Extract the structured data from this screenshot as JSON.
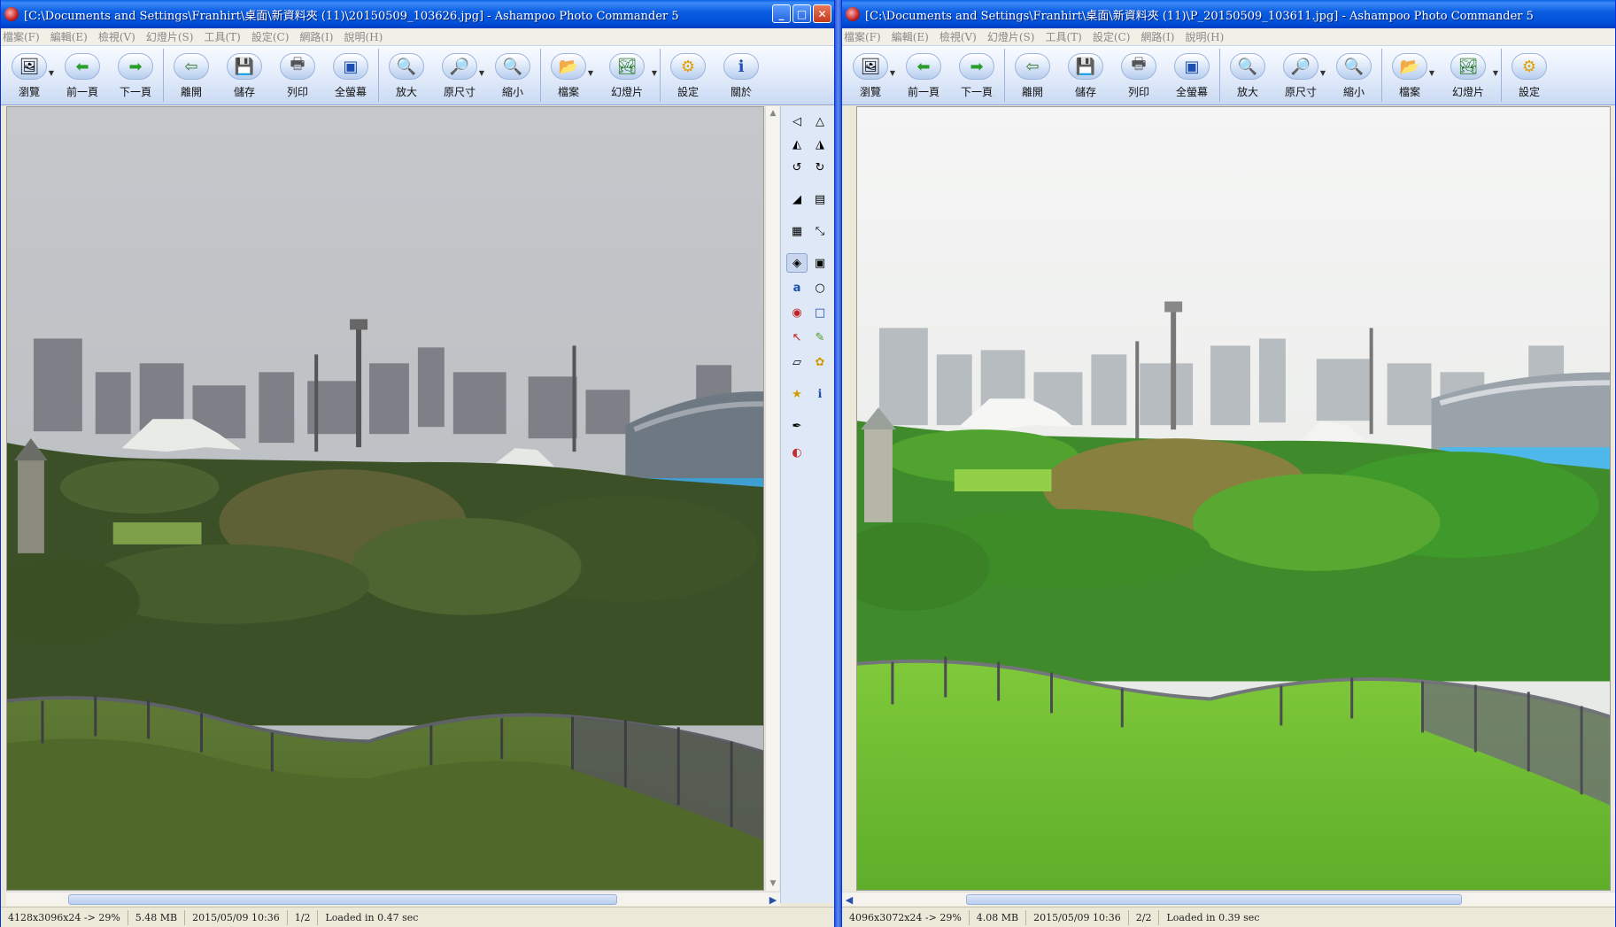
{
  "left": {
    "title": "[C:\\Documents and Settings\\Franhirt\\桌面\\新資料夾 (11)\\20150509_103626.jpg] - Ashampoo Photo Commander 5",
    "menu": [
      "檔案(F)",
      "編輯(E)",
      "檢視(V)",
      "幻燈片(S)",
      "工具(T)",
      "設定(C)",
      "網路(I)",
      "說明(H)"
    ],
    "toolbar": [
      "瀏覽",
      "前一頁",
      "下一頁",
      "離開",
      "儲存",
      "列印",
      "全螢幕",
      "放大",
      "原尺寸",
      "縮小",
      "檔案",
      "幻燈片",
      "設定",
      "關於"
    ],
    "status": {
      "dimensions": "4128x3096x24 -> 29%",
      "size": "5.48 MB",
      "date": "2015/05/09 10:36",
      "index": "1/2",
      "loaded": "Loaded in 0.47 sec"
    }
  },
  "right": {
    "title": "[C:\\Documents and Settings\\Franhirt\\桌面\\新資料夾 (11)\\P_20150509_103611.jpg] - Ashampoo Photo Commander 5",
    "menu": [
      "檔案(F)",
      "編輯(E)",
      "檢視(V)",
      "幻燈片(S)",
      "工具(T)",
      "設定(C)",
      "網路(I)",
      "說明(H)"
    ],
    "toolbar": [
      "瀏覽",
      "前一頁",
      "下一頁",
      "離開",
      "儲存",
      "列印",
      "全螢幕",
      "放大",
      "原尺寸",
      "縮小",
      "檔案",
      "幻燈片",
      "設定"
    ],
    "status": {
      "dimensions": "4096x3072x24 -> 29%",
      "size": "4.08 MB",
      "date": "2015/05/09 10:36",
      "index": "2/2",
      "loaded": "Loaded in 0.39 sec"
    }
  },
  "title_buttons": {
    "minimize": "_",
    "maximize": "□",
    "close": "✕"
  },
  "icons": {
    "toolbar": [
      "browse-icon",
      "previous-icon",
      "next-icon",
      "exit-icon",
      "save-icon",
      "print-icon",
      "fullscreen-icon",
      "zoom-in-icon",
      "actual-size-icon",
      "zoom-out-icon",
      "file-icon",
      "slideshow-icon",
      "settings-icon",
      "about-icon"
    ],
    "side": [
      "rotate-left-icon",
      "flip-vertical-icon",
      "flip-horizontal-icon",
      "rotate-right-icon",
      "rotate-180-icon",
      "reset-icon",
      "eraser-icon",
      "image-icon",
      "insert-picture-icon",
      "resize-icon",
      "crop-tool-icon",
      "select-icon",
      "text-icon",
      "speech-bubble-icon",
      "red-eye-icon",
      "rectangle-icon",
      "arrow-icon",
      "pencil-icon",
      "eraser-icon",
      "clone-icon",
      "sticker-icon",
      "info-icon",
      "color-picker-icon",
      "color-palette-icon"
    ]
  }
}
